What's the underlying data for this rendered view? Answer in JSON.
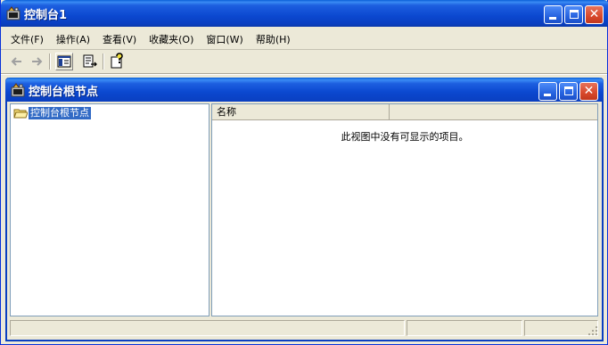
{
  "window": {
    "title": "控制台1"
  },
  "menu": {
    "items": [
      {
        "label": "文件(F)"
      },
      {
        "label": "操作(A)"
      },
      {
        "label": "查看(V)"
      },
      {
        "label": "收藏夹(O)"
      },
      {
        "label": "窗口(W)"
      },
      {
        "label": "帮助(H)"
      }
    ]
  },
  "toolbar": {
    "icons": [
      "back-arrow-icon",
      "forward-arrow-icon",
      "show-hide-tree-icon",
      "export-list-icon",
      "help-icon"
    ]
  },
  "inner_window": {
    "title": "控制台根节点"
  },
  "tree": {
    "root_label": "控制台根节点"
  },
  "list": {
    "columns": [
      {
        "label": "名称"
      },
      {
        "label": ""
      }
    ],
    "empty_message": "此视图中没有可显示的项目。"
  },
  "colors": {
    "titlebar_blue": "#0b48d0",
    "window_face": "#ece9d8",
    "close_red": "#d8482b",
    "selection": "#316ac5"
  }
}
